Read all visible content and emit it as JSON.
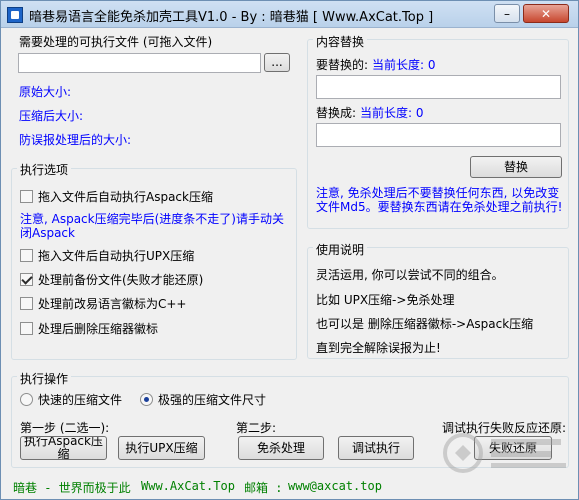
{
  "window": {
    "title": "暗巷易语言全能免杀加壳工具V1.0 - By : 暗巷猫 [ Www.AxCat.Top ]",
    "minimize_glyph": "–",
    "close_glyph": "✕"
  },
  "file_section": {
    "label": "需要处理的可执行文件 (可拖入文件)",
    "file_value": "",
    "browse_label": "...",
    "original_size_label": "原始大小:",
    "compressed_size_label": "压缩后大小:",
    "anti_fp_size_label": "防误报处理后的大小:"
  },
  "options": {
    "legend": "执行选项",
    "aspack_auto": {
      "label": "拖入文件后自动执行Aspack压缩",
      "checked": false
    },
    "aspack_note": "注意, Aspack压缩完毕后(进度条不走了)请手动关闭Aspack",
    "upx_auto": {
      "label": "拖入文件后自动执行UPX压缩",
      "checked": false
    },
    "backup": {
      "label": "处理前备份文件(失败才能还原)",
      "checked": true
    },
    "change_icon": {
      "label": "处理前改易语言徽标为C++",
      "checked": false
    },
    "delete_icon": {
      "label": "处理后删除压缩器徽标",
      "checked": false
    }
  },
  "replace": {
    "legend": "内容替换",
    "find_label": "要替换的:",
    "find_length": "当前长度: 0",
    "find_value": "",
    "with_label": "替换成:",
    "with_length": "当前长度: 0",
    "with_value": "",
    "button": "替换",
    "note": "注意, 免杀处理后不要替换任何东西, 以免改变文件Md5。要替换东西请在免杀处理之前执行!"
  },
  "help": {
    "legend": "使用说明",
    "lines": [
      "灵活运用, 你可以尝试不同的组合。",
      "比如 UPX压缩->免杀处理",
      "也可以是 删除压缩器徽标->Aspack压缩",
      "直到完全解除误报为止!"
    ]
  },
  "actions": {
    "legend": "执行操作",
    "radio_fast": {
      "label": "快速的压缩文件",
      "selected": false
    },
    "radio_strong": {
      "label": "极强的压缩文件尺寸",
      "selected": true
    },
    "step1_label": "第一步 (二选一):",
    "step2_label": "第二步:",
    "restore_label": "调试执行失败反应还原:",
    "btn_aspack": "执行Aspack压缩",
    "btn_upx": "执行UPX压缩",
    "btn_antivirus": "免杀处理",
    "btn_debug": "调试执行",
    "btn_restore": "失败还原"
  },
  "status": {
    "left": "暗巷 - 世界而极于此",
    "site": "Www.AxCat.Top",
    "mail_label": "邮箱 :",
    "mail": "www@axcat.top"
  },
  "colors": {
    "accent_blue": "#0000ff",
    "status_green": "#008000"
  }
}
